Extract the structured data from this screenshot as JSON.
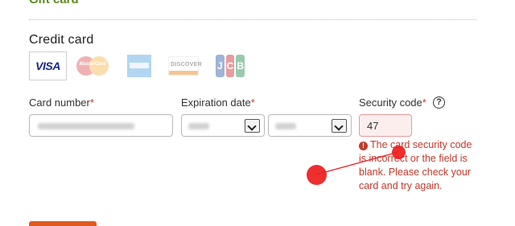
{
  "gift_card": {
    "heading": "Gift card"
  },
  "credit_card": {
    "title": "Credit card",
    "brands": [
      {
        "name": "VISA",
        "icon": "visa-logo-icon",
        "selected": true
      },
      {
        "name": "MasterCard",
        "icon": "mastercard-logo-icon",
        "selected": false
      },
      {
        "name": "American Express",
        "icon": "amex-logo-icon",
        "selected": false
      },
      {
        "name": "DISCOVER",
        "icon": "discover-logo-icon",
        "selected": false
      },
      {
        "name": "JCB",
        "icon": "jcb-logo-icon",
        "selected": false
      }
    ]
  },
  "form": {
    "card_number": {
      "label": "Card number",
      "required_mark": "*",
      "value_obscured": true
    },
    "expiration": {
      "label": "Expiration date",
      "required_mark": "*",
      "month": {
        "value_obscured": true
      },
      "year": {
        "value_obscured": true
      }
    },
    "security_code": {
      "label": "Security code",
      "required_mark": "*",
      "value": "47",
      "help_glyph": "?",
      "error_icon": "!",
      "error_text": "The card security code is incorrect or the field is blank. Please check your card and try again."
    }
  },
  "colors": {
    "accent_green": "#5c8a1e",
    "error_red": "#c0392b",
    "button_orange": "#e05a1f",
    "marker_red": "#ee1c1c"
  }
}
